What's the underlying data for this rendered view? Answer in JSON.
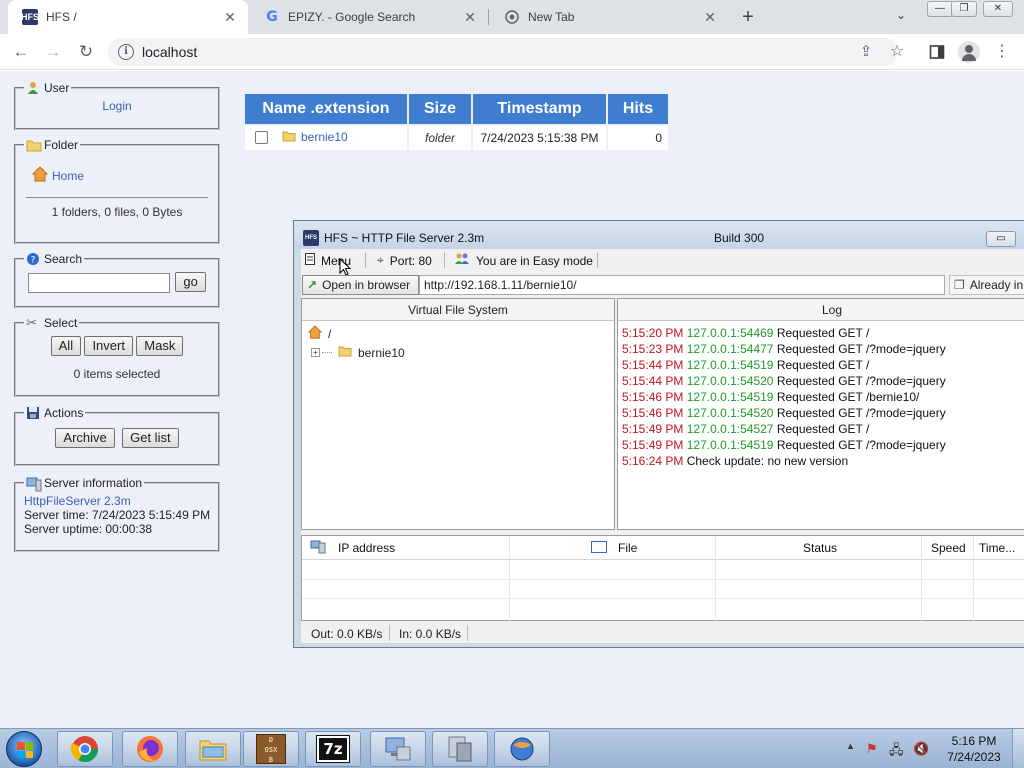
{
  "browser": {
    "tabs": [
      {
        "title": "HFS /",
        "active": true
      },
      {
        "title": "EPIZY. - Google Search",
        "active": false
      },
      {
        "title": "New Tab",
        "active": false
      }
    ],
    "address": "localhost"
  },
  "sidebar": {
    "user": {
      "legend": "User",
      "login": "Login"
    },
    "folder": {
      "legend": "Folder",
      "home": "Home",
      "summary": "1 folders, 0 files, 0 Bytes"
    },
    "search": {
      "legend": "Search",
      "go": "go"
    },
    "select": {
      "legend": "Select",
      "all": "All",
      "invert": "Invert",
      "mask": "Mask",
      "selected": "0 items selected"
    },
    "actions": {
      "legend": "Actions",
      "archive": "Archive",
      "getlist": "Get list"
    },
    "server": {
      "legend": "Server information",
      "product": "HttpFileServer 2.3m",
      "time": "Server time: 7/24/2023 5:15:49 PM",
      "uptime": "Server uptime: 00:00:38"
    }
  },
  "filelist": {
    "headers": [
      "Name .extension",
      "Size",
      "Timestamp",
      "Hits"
    ],
    "rows": [
      {
        "name": "bernie10",
        "size": "folder",
        "timestamp": "7/24/2023 5:15:38 PM",
        "hits": "0"
      }
    ]
  },
  "hfs": {
    "title": "HFS ~ HTTP File Server 2.3m",
    "build": "Build 300",
    "menu": "Menu",
    "port": "Port: 80",
    "mode": "You are in Easy mode",
    "open_browser": "Open in browser",
    "url": "http://192.168.1.11/bernie10/",
    "already": "Already in",
    "vfs_header": "Virtual File System",
    "vfs_root": "/",
    "vfs_child": "bernie10",
    "log_header": "Log",
    "log": [
      {
        "time": "5:15:20 PM",
        "ip": "127.0.0.1:54469",
        "msg": "Requested GET /"
      },
      {
        "time": "5:15:23 PM",
        "ip": "127.0.0.1:54477",
        "msg": "Requested GET /?mode=jquery"
      },
      {
        "time": "5:15:44 PM",
        "ip": "127.0.0.1:54519",
        "msg": "Requested GET /"
      },
      {
        "time": "5:15:44 PM",
        "ip": "127.0.0.1:54520",
        "msg": "Requested GET /?mode=jquery"
      },
      {
        "time": "5:15:46 PM",
        "ip": "127.0.0.1:54519",
        "msg": "Requested GET /bernie10/"
      },
      {
        "time": "5:15:46 PM",
        "ip": "127.0.0.1:54520",
        "msg": "Requested GET /?mode=jquery"
      },
      {
        "time": "5:15:49 PM",
        "ip": "127.0.0.1:54527",
        "msg": "Requested GET /"
      },
      {
        "time": "5:15:49 PM",
        "ip": "127.0.0.1:54519",
        "msg": "Requested GET /?mode=jquery"
      },
      {
        "time": "5:16:24 PM",
        "ip": "",
        "msg": "Check update: no new version"
      }
    ],
    "conn_headers": [
      "IP address",
      "File",
      "Status",
      "Speed",
      "Time..."
    ],
    "out": "Out: 0.0 KB/s",
    "in": "In: 0.0 KB/s"
  },
  "taskbar": {
    "time": "5:16 PM",
    "date": "7/24/2023"
  },
  "colors": {
    "accent": "#3f7dd1",
    "page_bg": "#eef0f9",
    "log_time": "#c0141c",
    "log_ip": "#1f9a26"
  }
}
